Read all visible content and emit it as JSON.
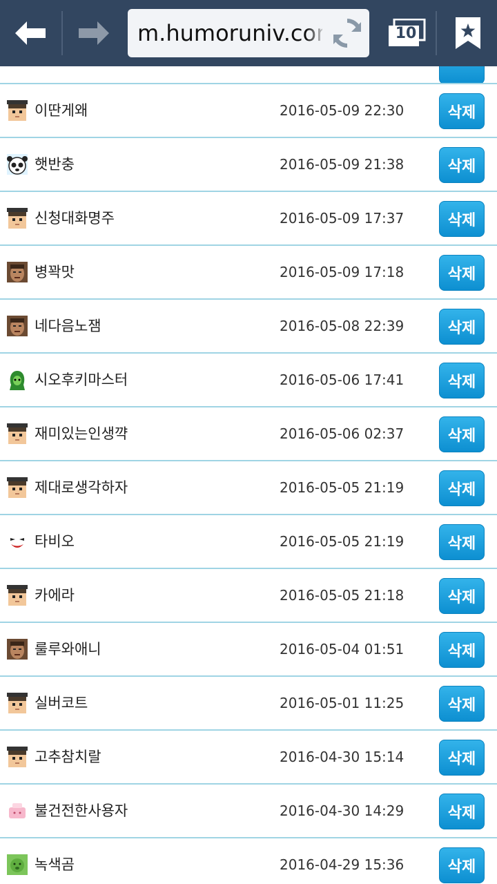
{
  "browser": {
    "url": "m.humoruniv.com",
    "tab_count": "10",
    "icons": {
      "back": "back-arrow-icon",
      "forward": "forward-arrow-icon",
      "refresh": "refresh-icon",
      "tabs": "tabs-icon",
      "bookmark": "bookmark-star-icon"
    }
  },
  "list": {
    "delete_label": "삭제",
    "rows": [
      {
        "nick": "이딴게왜",
        "date": "2016-05-09 22:30",
        "avatar": "student-avatar-icon"
      },
      {
        "nick": "햇반충",
        "date": "2016-05-09 21:38",
        "avatar": "panda-avatar-icon"
      },
      {
        "nick": "신청대화명주",
        "date": "2016-05-09 17:37",
        "avatar": "student-avatar-icon"
      },
      {
        "nick": "병꽉맛",
        "date": "2016-05-09 17:18",
        "avatar": "photo-avatar-icon"
      },
      {
        "nick": "네다음노잼",
        "date": "2016-05-08 22:39",
        "avatar": "photo-avatar-icon"
      },
      {
        "nick": "시오후키마스터",
        "date": "2016-05-06 17:41",
        "avatar": "green-character-avatar-icon"
      },
      {
        "nick": "재미있는인생꺅",
        "date": "2016-05-06 02:37",
        "avatar": "student-avatar-icon"
      },
      {
        "nick": "제대로생각하자",
        "date": "2016-05-05 21:19",
        "avatar": "student-avatar-icon"
      },
      {
        "nick": "타비오",
        "date": "2016-05-05 21:19",
        "avatar": "joker-avatar-icon"
      },
      {
        "nick": "카에라",
        "date": "2016-05-05 21:18",
        "avatar": "student-avatar-icon"
      },
      {
        "nick": "룰루와애니",
        "date": "2016-05-04 01:51",
        "avatar": "photo-avatar-icon"
      },
      {
        "nick": "실버코트",
        "date": "2016-05-01 11:25",
        "avatar": "student-avatar-icon"
      },
      {
        "nick": "고추참치랄",
        "date": "2016-04-30 15:14",
        "avatar": "student-avatar-icon"
      },
      {
        "nick": "불건전한사용자",
        "date": "2016-04-30 14:29",
        "avatar": "pink-box-avatar-icon"
      },
      {
        "nick": "녹색곰",
        "date": "2016-04-29 15:36",
        "avatar": "green-bear-avatar-icon"
      }
    ]
  },
  "colors": {
    "toolbar_bg": "#324660",
    "row_divider": "#9fd4e4",
    "button_blue": "#1a9ddc"
  }
}
